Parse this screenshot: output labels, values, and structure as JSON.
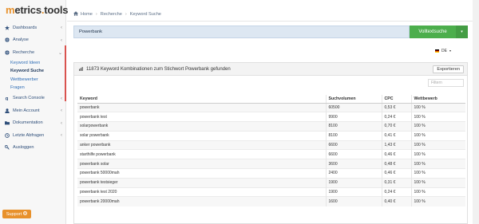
{
  "brand": {
    "part1": "m",
    "part2": "etrics",
    "dot": ".",
    "part3": "tools"
  },
  "sidebar": {
    "items": [
      {
        "label": "Dashboards",
        "icon": "star-icon",
        "chevron": "‹"
      },
      {
        "label": "Analyse",
        "icon": "globe-icon",
        "chevron": "‹"
      },
      {
        "label": "Recherche",
        "icon": "globe-icon",
        "chevron": "⌄"
      },
      {
        "label": "Search Console",
        "icon": "google-icon",
        "chevron": "‹"
      },
      {
        "label": "Mein Account",
        "icon": "user-icon",
        "chevron": "‹"
      },
      {
        "label": "Dokumentation",
        "icon": "folder-icon",
        "chevron": "‹"
      },
      {
        "label": "Letzte Abfragen",
        "icon": "history-icon",
        "chevron": "‹"
      },
      {
        "label": "Ausloggen",
        "icon": "key-icon",
        "chevron": ""
      }
    ],
    "subitems": [
      {
        "label": "Keyword Ideen"
      },
      {
        "label": "Keyword Suche"
      },
      {
        "label": "Wettbewerber"
      },
      {
        "label": "Fragen"
      }
    ],
    "support_label": "Support"
  },
  "breadcrumb": {
    "home": "Home",
    "section": "Recherche",
    "page": "Keyword Suche",
    "separator": "›"
  },
  "search": {
    "value": "Powerbank",
    "button_label": "Volltextsuche",
    "dropdown": "▾"
  },
  "language": {
    "code": "DE",
    "caret": "▾"
  },
  "results": {
    "header": "11873 Keyword Kombinationen zum Stichwort Powerbank gefunden",
    "export_label": "Exportieren",
    "filter_placeholder": "Filtern",
    "columns": [
      "Keyword",
      "Suchvolumen",
      "CPC",
      "Wettbewerb"
    ],
    "rows": [
      [
        "powerbank",
        "60500",
        "0,53 €",
        "100 %"
      ],
      [
        "powerbank test",
        "9900",
        "0,24 €",
        "100 %"
      ],
      [
        "solarpowerbank",
        "8100",
        "0,70 €",
        "100 %"
      ],
      [
        "solar powerbank",
        "8100",
        "0,41 €",
        "100 %"
      ],
      [
        "anker powerbank",
        "6600",
        "1,43 €",
        "100 %"
      ],
      [
        "starthilfe powerbank",
        "6600",
        "0,46 €",
        "100 %"
      ],
      [
        "powerbank solar",
        "3600",
        "0,48 €",
        "100 %"
      ],
      [
        "powerbank 50000mah",
        "2400",
        "0,46 €",
        "100 %"
      ],
      [
        "powerbank testsieger",
        "1900",
        "0,31 €",
        "100 %"
      ],
      [
        "powerbank test 2020",
        "1900",
        "0,24 €",
        "100 %"
      ],
      [
        "powerbank 20000mah",
        "1600",
        "0,40 €",
        "100 %"
      ]
    ]
  },
  "colors": {
    "accent": "#e8912b",
    "primary_button": "#4cae4c",
    "nav_text": "#2f4f7a",
    "active_marker": "#d9534f"
  }
}
